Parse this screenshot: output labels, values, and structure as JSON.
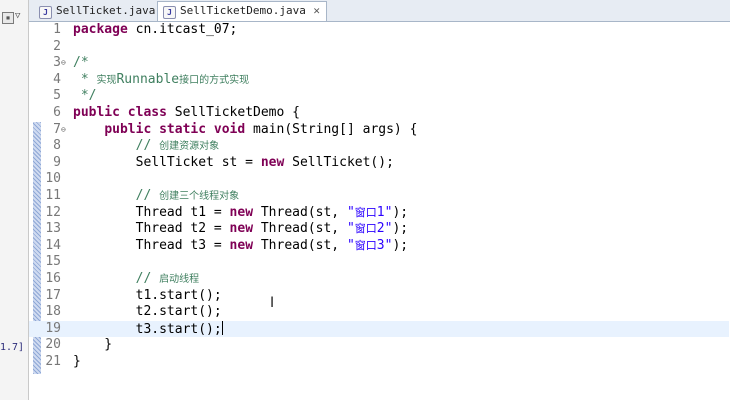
{
  "sidebar": {
    "truncated_text": "1.7]"
  },
  "tabs": [
    {
      "label": "SellTicket.java",
      "active": false
    },
    {
      "label": "SellTicketDemo.java",
      "active": true
    }
  ],
  "editor": {
    "lines": [
      {
        "n": "1",
        "t": "package cn.itcast_07;"
      },
      {
        "n": "2",
        "t": ""
      },
      {
        "n": "3",
        "t": "/*"
      },
      {
        "n": "4",
        "t": " * 实现Runnable接口的方式实现"
      },
      {
        "n": "5",
        "t": " */"
      },
      {
        "n": "6",
        "t": "public class SellTicketDemo {"
      },
      {
        "n": "7",
        "t": "    public static void main(String[] args) {"
      },
      {
        "n": "8",
        "t": "        // 创建资源对象"
      },
      {
        "n": "9",
        "t": "        SellTicket st = new SellTicket();"
      },
      {
        "n": "10",
        "t": ""
      },
      {
        "n": "11",
        "t": "        // 创建三个线程对象"
      },
      {
        "n": "12",
        "t": "        Thread t1 = new Thread(st, \"窗口1\");"
      },
      {
        "n": "13",
        "t": "        Thread t2 = new Thread(st, \"窗口2\");"
      },
      {
        "n": "14",
        "t": "        Thread t3 = new Thread(st, \"窗口3\");"
      },
      {
        "n": "15",
        "t": ""
      },
      {
        "n": "16",
        "t": "        // 启动线程"
      },
      {
        "n": "17",
        "t": "        t1.start();"
      },
      {
        "n": "18",
        "t": "        t2.start();"
      },
      {
        "n": "19",
        "t": "        t3.start();"
      },
      {
        "n": "20",
        "t": "    }"
      },
      {
        "n": "21",
        "t": "}"
      }
    ],
    "current_line": 19
  },
  "colors": {
    "keyword": "#7f0055",
    "comment": "#3f7f5f",
    "string": "#2a00ff",
    "line_highlight": "#e8f2fe"
  }
}
